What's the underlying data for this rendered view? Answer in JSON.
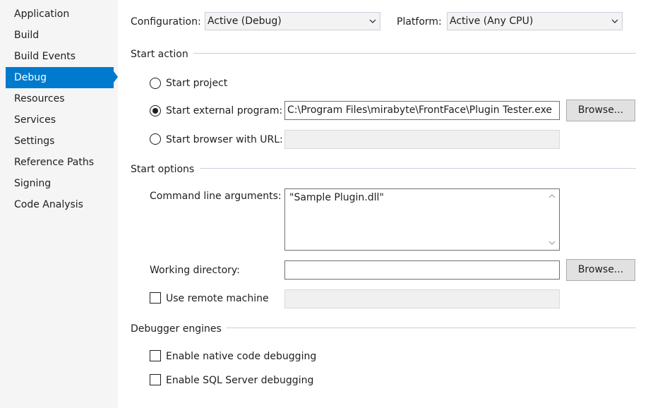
{
  "sidebar": {
    "items": [
      {
        "label": "Application"
      },
      {
        "label": "Build"
      },
      {
        "label": "Build Events"
      },
      {
        "label": "Debug"
      },
      {
        "label": "Resources"
      },
      {
        "label": "Services"
      },
      {
        "label": "Settings"
      },
      {
        "label": "Reference Paths"
      },
      {
        "label": "Signing"
      },
      {
        "label": "Code Analysis"
      }
    ],
    "active_item": "Debug"
  },
  "configuration": {
    "label": "Configuration:",
    "value": "Active (Debug)"
  },
  "platform": {
    "label": "Platform:",
    "value": "Active (Any CPU)"
  },
  "start_action": {
    "heading": "Start action",
    "start_project_label": "Start project",
    "start_external_label": "Start external program:",
    "external_program_value": "C:\\Program Files\\mirabyte\\FrontFace\\Plugin Tester.exe",
    "start_browser_label": "Start browser with URL:",
    "browser_url_value": "",
    "selected": "start_external",
    "browse_label": "Browse..."
  },
  "start_options": {
    "heading": "Start options",
    "cmd_args_label": "Command line arguments:",
    "cmd_args_value": "\"Sample Plugin.dll\"",
    "working_dir_label": "Working directory:",
    "working_dir_value": "",
    "browse_label": "Browse...",
    "remote_machine_label": "Use remote machine",
    "remote_machine_checked": false,
    "remote_machine_value": ""
  },
  "debugger_engines": {
    "heading": "Debugger engines",
    "native_label": "Enable native code debugging",
    "native_checked": false,
    "sql_label": "Enable SQL Server debugging",
    "sql_checked": false
  },
  "colors": {
    "accent": "#007acc",
    "sidebar_bg": "#f5f5f5"
  }
}
